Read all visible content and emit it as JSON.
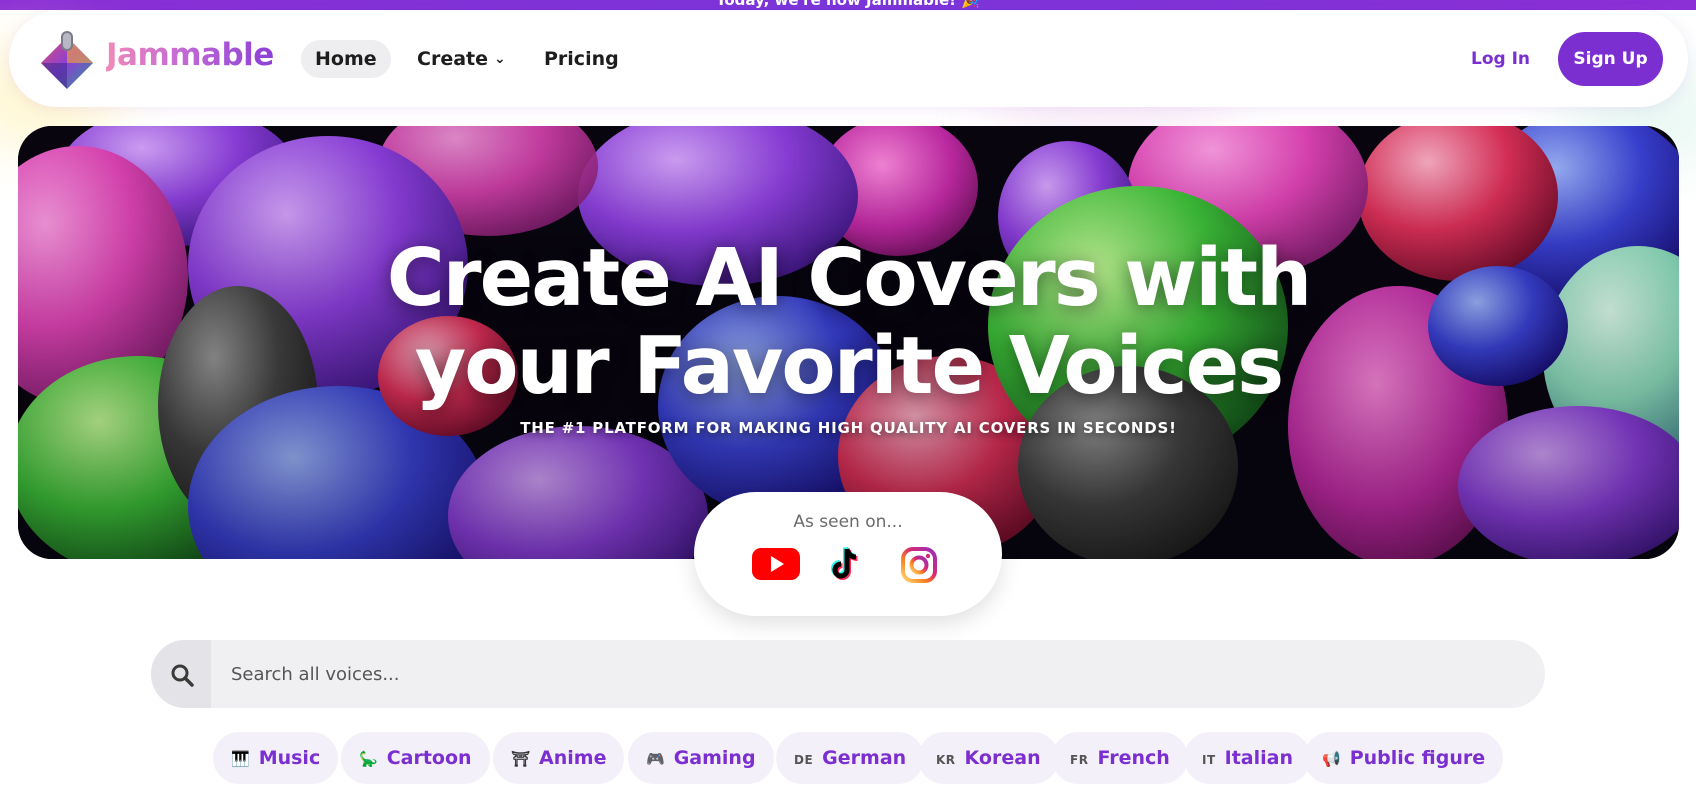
{
  "banner": {
    "text": "Today, we're now Jammable! 🎉"
  },
  "brand": {
    "name": "Jammable",
    "accent": "#7b2fd0"
  },
  "nav": {
    "home": "Home",
    "create": "Create",
    "pricing": "Pricing",
    "login": "Log In",
    "signup": "Sign Up"
  },
  "hero": {
    "title_line1": "Create AI Covers with",
    "title_line2": "your Favorite Voices",
    "subtitle": "THE #1 PLATFORM FOR MAKING HIGH QUALITY AI COVERS IN SECONDS!"
  },
  "seen_on": {
    "label": "As seen on...",
    "platforms": [
      "youtube-icon",
      "tiktok-icon",
      "instagram-icon"
    ]
  },
  "search": {
    "placeholder": "Search all voices..."
  },
  "categories": [
    {
      "label": "Music",
      "icon": "🎹"
    },
    {
      "label": "Cartoon",
      "icon": "🦕"
    },
    {
      "label": "Anime",
      "icon": "⛩"
    },
    {
      "label": "Gaming",
      "icon": "🎮"
    },
    {
      "label": "German",
      "tag": "DE"
    },
    {
      "label": "Korean",
      "tag": "KR"
    },
    {
      "label": "French",
      "tag": "FR"
    },
    {
      "label": "Italian",
      "tag": "IT"
    },
    {
      "label": "Public figure",
      "icon": "📢"
    }
  ]
}
